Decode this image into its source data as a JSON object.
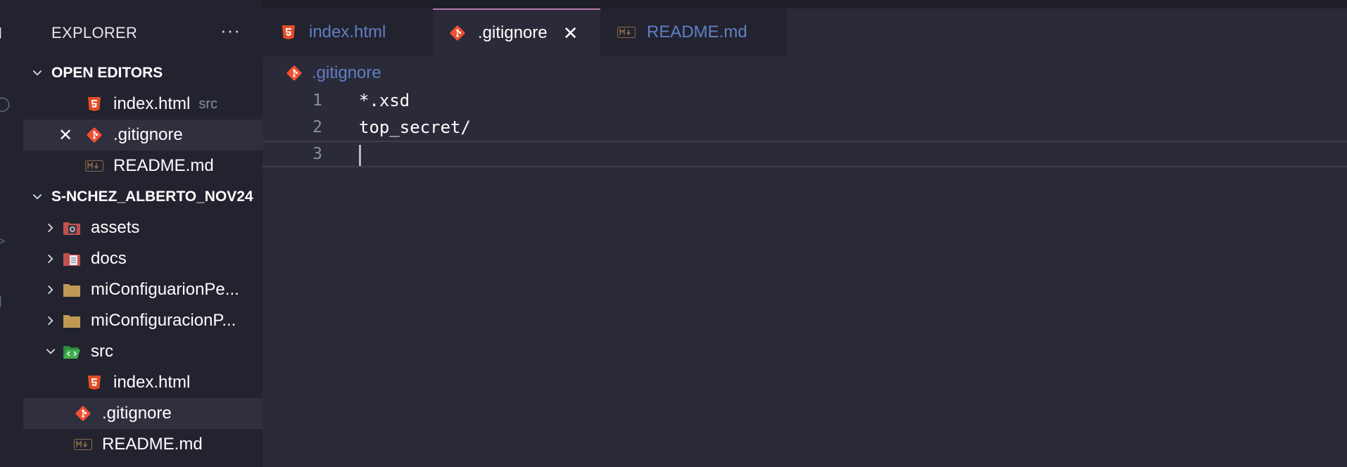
{
  "sidebar": {
    "title": "EXPLORER",
    "more": "···",
    "open_editors": {
      "title": "OPEN EDITORS",
      "items": [
        {
          "name": "index.html",
          "sub": "src",
          "icon": "html5-icon"
        },
        {
          "name": ".gitignore",
          "icon": "git-icon",
          "close": "✕"
        },
        {
          "name": "README.md",
          "icon": "markdown-icon"
        }
      ]
    },
    "project": {
      "title": "S-NCHEZ_ALBERTO_NOV24",
      "items": [
        {
          "name": "assets",
          "icon": "folder-assets-icon",
          "kind": "folder"
        },
        {
          "name": "docs",
          "icon": "folder-docs-icon",
          "kind": "folder"
        },
        {
          "name": "miConfiguarionPe...",
          "icon": "folder-icon",
          "kind": "folder"
        },
        {
          "name": "miConfiguracionP...",
          "icon": "folder-icon",
          "kind": "folder"
        },
        {
          "name": "src",
          "icon": "folder-src-open-icon",
          "kind": "folder-open"
        },
        {
          "name": "index.html",
          "icon": "html5-icon",
          "kind": "file"
        },
        {
          "name": ".gitignore",
          "icon": "git-icon",
          "kind": "file"
        },
        {
          "name": "README.md",
          "icon": "markdown-icon",
          "kind": "file"
        }
      ]
    }
  },
  "tabs": [
    {
      "label": "index.html",
      "icon": "html5-icon"
    },
    {
      "label": ".gitignore",
      "icon": "git-icon",
      "close": "✕"
    },
    {
      "label": "README.md",
      "icon": "markdown-icon"
    }
  ],
  "breadcrumb": {
    "file": ".gitignore"
  },
  "editor": {
    "lines": [
      {
        "number": "1",
        "text": "*.xsd"
      },
      {
        "number": "2",
        "text": "top_secret/"
      },
      {
        "number": "3",
        "text": ""
      }
    ]
  },
  "colors": {
    "accent": "#b478a8",
    "html": "#e44d26",
    "git": "#f05033",
    "tab_inactive": "#5f7fc4"
  }
}
